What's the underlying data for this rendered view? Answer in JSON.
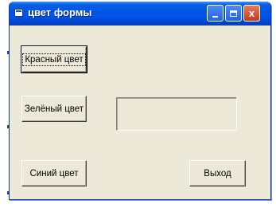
{
  "window": {
    "title": "цвет формы",
    "icon": "form-icon",
    "controls": [
      "minimize-icon",
      "maximize-icon",
      "close-icon"
    ],
    "close_glyph": "x"
  },
  "buttons": {
    "red": "Красный цвет",
    "green": "Зелёный цвет",
    "blue": "Синий цвет",
    "exit": "Выход"
  },
  "textbox": {
    "value": ""
  },
  "colors": {
    "titlebar": "#0054e3",
    "window_face": "#ece9d8",
    "close_button": "#c53920"
  }
}
